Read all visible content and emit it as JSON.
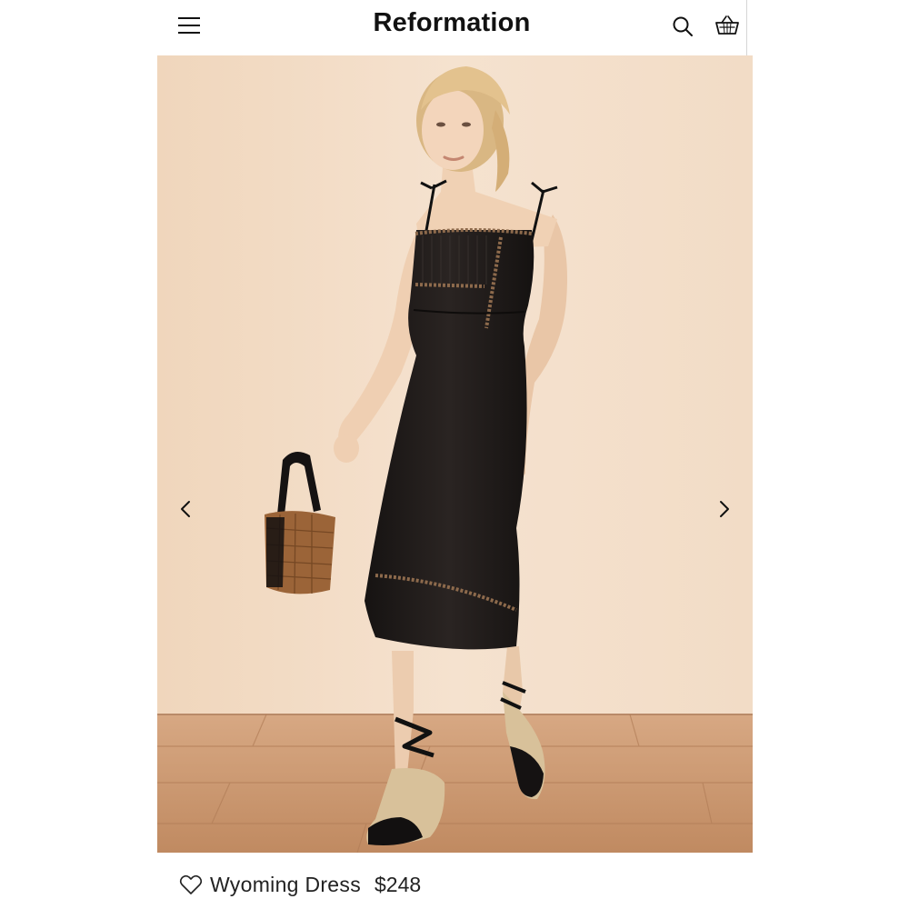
{
  "header": {
    "brand": "Reformation",
    "icons": [
      "menu-icon",
      "search-icon",
      "shopping-bag-icon"
    ]
  },
  "hero": {
    "image_alt": "Model wearing a black midi dress with lace trim, holding a woven basket bag",
    "prev_icon": "chevron-left-icon",
    "next_icon": "chevron-right-icon"
  },
  "product": {
    "name": "Wyoming Dress",
    "price": "$248",
    "wishlist_icon": "heart-outline-icon"
  },
  "colors": {
    "wall": "#f2dcc4",
    "floor": "#c8946a",
    "dress": "#1f1b1a",
    "text": "#111111"
  }
}
